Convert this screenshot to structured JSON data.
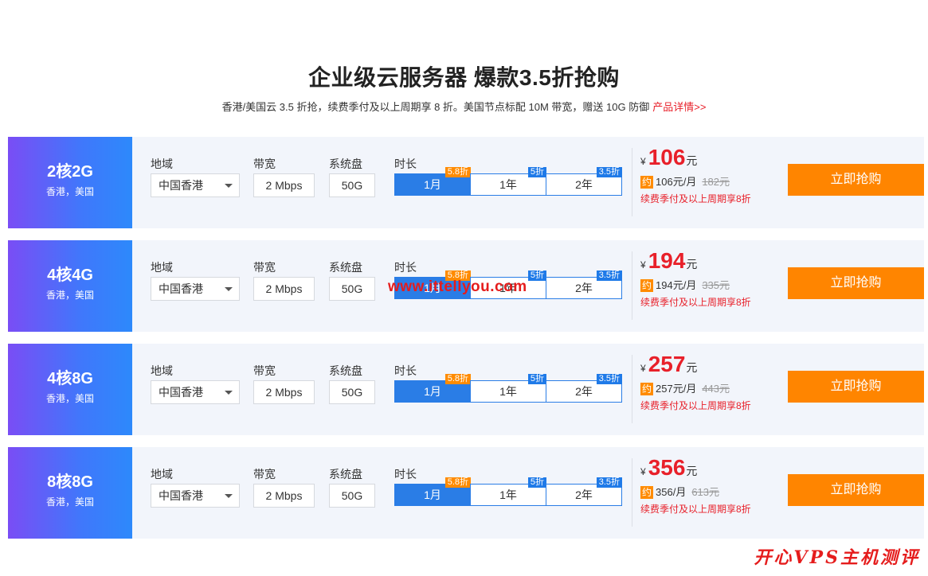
{
  "header": {
    "title": "企业级云服务器 爆款3.5折抢购",
    "subtitle": "香港/美国云 3.5 折抢，续费季付及以上周期享 8 折。美国节点标配 10M 带宽，赠送 10G 防御",
    "detail_link": "产品详情>>"
  },
  "labels": {
    "region": "地域",
    "bandwidth": "带宽",
    "disk": "系统盘",
    "duration": "时长",
    "currency": "¥",
    "price_unit": "元",
    "approx": "约",
    "buy": "立即抢购"
  },
  "plans": [
    {
      "spec": "2核2G",
      "regions": "香港，美国",
      "region": "中国香港",
      "bandwidth": "2 Mbps",
      "disk": "50G",
      "durations": [
        {
          "label": "1月",
          "badge": "5.8折"
        },
        {
          "label": "1年",
          "badge": "5折"
        },
        {
          "label": "2年",
          "badge": "3.5折"
        }
      ],
      "selected_duration": "1月",
      "price": "106",
      "monthly": "106元/月",
      "original": "182元",
      "note": "续费季付及以上周期享8折"
    },
    {
      "spec": "4核4G",
      "regions": "香港，美国",
      "region": "中国香港",
      "bandwidth": "2 Mbps",
      "disk": "50G",
      "durations": [
        {
          "label": "1月",
          "badge": "5.8折"
        },
        {
          "label": "1年",
          "badge": "5折"
        },
        {
          "label": "2年",
          "badge": "3.5折"
        }
      ],
      "selected_duration": "1月",
      "price": "194",
      "monthly": "194元/月",
      "original": "335元",
      "note": "续费季付及以上周期享8折"
    },
    {
      "spec": "4核8G",
      "regions": "香港，美国",
      "region": "中国香港",
      "bandwidth": "2 Mbps",
      "disk": "50G",
      "durations": [
        {
          "label": "1月",
          "badge": "5.8折"
        },
        {
          "label": "1年",
          "badge": "5折"
        },
        {
          "label": "2年",
          "badge": "3.5折"
        }
      ],
      "selected_duration": "1月",
      "price": "257",
      "monthly": "257元/月",
      "original": "443元",
      "note": "续费季付及以上周期享8折"
    },
    {
      "spec": "8核8G",
      "regions": "香港，美国",
      "region": "中国香港",
      "bandwidth": "2 Mbps",
      "disk": "50G",
      "durations": [
        {
          "label": "1月",
          "badge": "5.8折"
        },
        {
          "label": "1年",
          "badge": "5折"
        },
        {
          "label": "2年",
          "badge": "3.5折"
        }
      ],
      "selected_duration": "1月",
      "price": "356",
      "monthly": "356/月",
      "original": "613元",
      "note": "续费季付及以上周期享8折"
    }
  ],
  "watermarks": {
    "url": "www.ittellyou.com",
    "brand": "开心VPS主机测评"
  },
  "colors": {
    "accent_blue": "#2a7de6",
    "price_red": "#e8202a",
    "button_orange": "#ff8500",
    "badge_orange": "#ff8b00",
    "card_bg": "#f2f5fb"
  }
}
